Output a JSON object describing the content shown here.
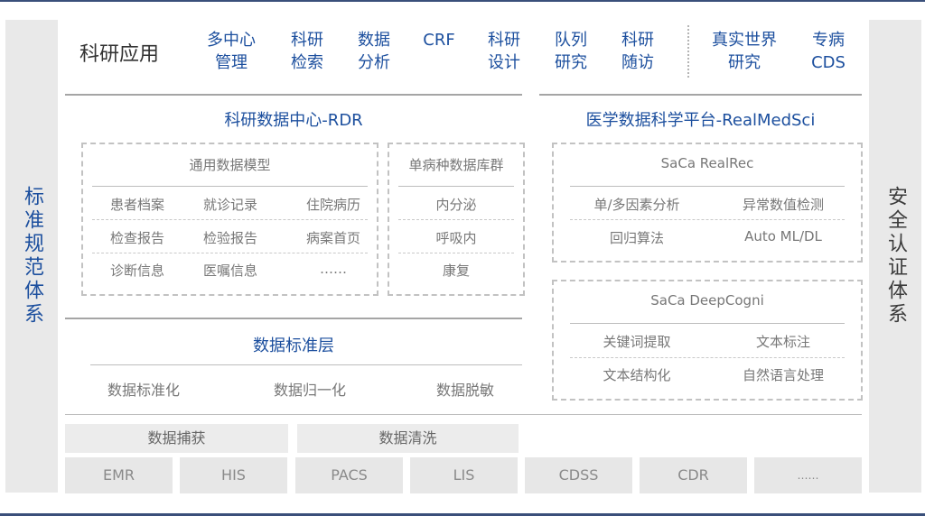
{
  "left_sidebar": "标准规范体系",
  "right_sidebar": "安全认证体系",
  "apps": {
    "title": "科研应用",
    "items": [
      "多中心\n管理",
      "科研\n检索",
      "数据\n分析",
      "CRF",
      "科研\n设计",
      "队列\n研究",
      "科研\n随访",
      "真实世界\n研究",
      "专病\nCDS"
    ]
  },
  "rdr": {
    "title": "科研数据中心-RDR",
    "general_model": {
      "title": "通用数据模型",
      "rows": [
        [
          "患者档案",
          "就诊记录",
          "住院病历"
        ],
        [
          "检查报告",
          "检验报告",
          "病案首页"
        ],
        [
          "诊断信息",
          "医嘱信息",
          "……"
        ]
      ]
    },
    "disease_db": {
      "title": "单病种数据库群",
      "items": [
        "内分泌",
        "呼吸内",
        "康复"
      ]
    }
  },
  "standard_layer": {
    "title": "数据标准层",
    "items": [
      "数据标准化",
      "数据归一化",
      "数据脱敏"
    ]
  },
  "realmedsci": {
    "title": "医学数据科学平台-RealMedSci",
    "realrec": {
      "title": "SaCa RealRec",
      "items": [
        "单/多因素分析",
        "异常数值检测",
        "回归算法",
        "Auto ML/DL"
      ]
    },
    "deepcogni": {
      "title": "SaCa DeepCogni",
      "items": [
        "关键词提取",
        "文本标注",
        "文本结构化",
        "自然语言处理"
      ]
    }
  },
  "data_ops": [
    "数据捕获",
    "数据清洗"
  ],
  "sources": [
    "EMR",
    "HIS",
    "PACS",
    "LIS",
    "CDSS",
    "CDR",
    "……"
  ],
  "colors": {
    "accent": "#1c4f9e",
    "sidebar_bg": "#e9e9e9",
    "gray_text": "#777777"
  }
}
